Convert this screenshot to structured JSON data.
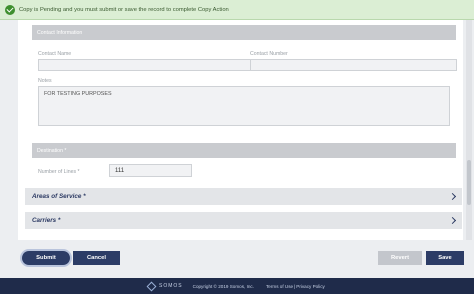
{
  "banner": {
    "icon": "check-circle-icon",
    "message": "Copy is Pending and you must submit or save the record to complete Copy Action"
  },
  "contact_section": {
    "title": "Contact Information",
    "contact_name_label": "Contact Name",
    "contact_name_value": "",
    "contact_number_label": "Contact Number",
    "contact_number_value": "",
    "notes_label": "Notes",
    "notes_value": "FOR TESTING PURPOSES"
  },
  "destination_section": {
    "title": "Destination *",
    "lines_label": "Number of Lines *",
    "lines_value": "111"
  },
  "accordions": {
    "areas_of_service": "Areas of Service *",
    "carriers": "Carriers *"
  },
  "actions": {
    "submit": "Submit",
    "cancel": "Cancel",
    "revert": "Revert",
    "save": "Save"
  },
  "footer": {
    "logo": "SOMOS",
    "copyright": "Copyright © 2019 Somos, Inc.",
    "terms": "Terms of Use",
    "privacy": "Privacy Policy",
    "separator": "|"
  },
  "colors": {
    "brand_navy": "#2c3c66",
    "banner_green": "#dbeed4",
    "section_gray": "#c9cbcf",
    "disabled_gray": "#c3c6cc"
  }
}
